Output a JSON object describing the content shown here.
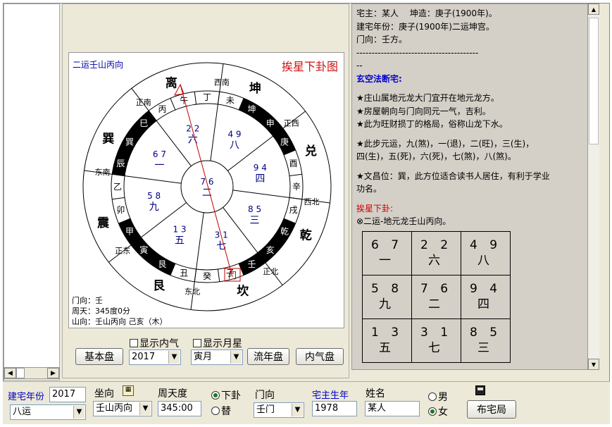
{
  "chart": {
    "title_left": "二运壬山丙向",
    "title_right": "挨星下卦图",
    "corner_lines": [
      "门向：壬",
      "周天：345度0分",
      "山向：壬山丙向 己亥（木）"
    ],
    "trigrams": [
      "离",
      "坤",
      "兑",
      "乾",
      "坎",
      "艮",
      "震",
      "巽"
    ],
    "directions": [
      "正南",
      "西南",
      "正西",
      "西北",
      "正北",
      "东北",
      "正东",
      "东南"
    ],
    "mountains": [
      "丙",
      "午",
      "丁",
      "未",
      "坤",
      "申",
      "庚",
      "酉",
      "辛",
      "戌",
      "乾",
      "亥",
      "壬",
      "子",
      "癸",
      "丑",
      "艮",
      "寅",
      "甲",
      "卯",
      "乙",
      "辰",
      "巽",
      "巳"
    ],
    "palaces": [
      {
        "stars": "6 7",
        "num": "一"
      },
      {
        "stars": "2 2",
        "num": "六"
      },
      {
        "stars": "4 9",
        "num": "八"
      },
      {
        "stars": "5 8",
        "num": "九"
      },
      {
        "stars": "7 6",
        "num": "二"
      },
      {
        "stars": "9 4",
        "num": "四"
      },
      {
        "stars": "1 3",
        "num": "五"
      },
      {
        "stars": "3 1",
        "num": "七"
      },
      {
        "stars": "8 5",
        "num": "三"
      }
    ],
    "gate": "门"
  },
  "buttons": {
    "basic": "基本盘",
    "flow_year": "流年盘",
    "inner_qi": "内气盘",
    "layout": "布宅局"
  },
  "checks": {
    "show_inner": "显示内气",
    "show_month": "显示月星"
  },
  "selects": {
    "year": "2017",
    "month": "寅月",
    "yun": "八运",
    "sit": "壬山丙向",
    "gate": "壬门"
  },
  "bottom": {
    "build_year_label": "建宅年份",
    "build_year": "2017",
    "sit_label": "坐向",
    "degree_label": "周天度",
    "degree": "345:00",
    "xiagua": "下卦",
    "tigua": "替",
    "gate_label": "门向",
    "owner_year_label": "宅主生年",
    "owner_year": "1978",
    "name_label": "姓名",
    "name": "某人",
    "male": "男",
    "female": "女"
  },
  "text": {
    "l1": "宅主：某人　 坤造：庚子(1900年)。",
    "l2": "建宅年份：庚子(1900年)二运坤宫。",
    "l3": "门向：壬方。",
    "sep": "----------------------------------------",
    "sep2": "--",
    "h1": "玄空法断宅:",
    "p1": "★庄山属地元龙大门宜开在地元龙方。",
    "p2": "★房屋朝向与门向同元一气，吉利。",
    "p3": "★此为旺财损丁的格局，俗称山龙下水。",
    "p4": "★此步元运，九(煞)，一(退)，二(旺)，三(生)，",
    "p5": "四(生)，五(死)，六(死)，七(煞)，八(煞)。",
    "p6": "★文昌位：巽，此方位适合读书人居住，有利于学业",
    "p7": "功名。",
    "h2": "挨星下卦:",
    "p8": "⊗二运-地元龙壬山丙向。",
    "grid": [
      [
        "6 7",
        "一"
      ],
      [
        "2 2",
        "六"
      ],
      [
        "4 9",
        "八"
      ],
      [
        "5 8",
        "九"
      ],
      [
        "7 6",
        "二"
      ],
      [
        "9 4",
        "四"
      ],
      [
        "1 3",
        "五"
      ],
      [
        "3 1",
        "七"
      ],
      [
        "8 5",
        "三"
      ]
    ]
  }
}
